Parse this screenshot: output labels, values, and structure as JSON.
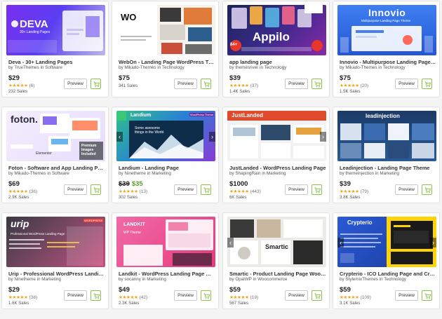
{
  "colors": {
    "star": "#f0a312",
    "cart_green": "#8cc34b",
    "sale_green": "#5a9e2a"
  },
  "buttons": {
    "preview_label": "Preview",
    "cart_icon": "shopping-cart-icon"
  },
  "items": [
    {
      "title": "Deva - 30+ Landing Pages",
      "byline": "by TrueThemes in Software",
      "price": "$29",
      "rating_count": "(6)",
      "sales": "232 Sales",
      "thumb_brand": "DEVA",
      "thumb_tagline": "30+ Landing Pages"
    },
    {
      "title": "WebOn - Landing Page WordPress Theme",
      "byline": "by Mikado-Themes in Technology",
      "price": "$75",
      "sales": "341 Sales"
    },
    {
      "title": "app landing page",
      "byline": "by themesriver in Technology",
      "price": "$39",
      "rating_count": "(37)",
      "sales": "1.4K Sales",
      "thumb_brand": "Appilo",
      "thumb_badge": "84+"
    },
    {
      "title": "Innovio - Multipurpose Landing Page Theme",
      "byline": "by Mikado-Themes in Technology",
      "price": "$75",
      "rating_count": "(20)",
      "sales": "1.5K Sales",
      "thumb_brand": "Innovio",
      "thumb_tagline": "Multipurpose Landing Page Theme"
    },
    {
      "title": "Foton - Software and App Landing Page",
      "byline": "by Mikado-Themes in Software",
      "price": "$69",
      "rating_count": "(36)",
      "sales": "2.9K Sales",
      "thumb_brand": "foton.",
      "thumb_badge": "Premium Images Included",
      "thumb_tagline": "Elementor"
    },
    {
      "title": "Landium - Landing Page",
      "byline": "by Ninetheme in Marketing",
      "price": "$39",
      "sale_price": "$35",
      "rating_count": "(13)",
      "sales": "302 Sales",
      "thumb_brand": "Landium",
      "thumb_tagline": "Some awesome things in the World",
      "thumb_badge": "WordPress Theme"
    },
    {
      "title": "JustLanded - WordPress Landing Page",
      "byline": "by ShapingRain in Marketing",
      "price": "$1000",
      "rating_count": "(443)",
      "sales": "6K Sales",
      "thumb_brand": "JustLanded"
    },
    {
      "title": "Leadinjection - Landing Page Theme",
      "byline": "by themeinjection in Marketing",
      "price": "$39",
      "rating_count": "(79)",
      "sales": "3.8K Sales",
      "thumb_brand": "leadinjection"
    },
    {
      "title": "Urip - Professional WordPress Landing Page",
      "byline": "by Ninetheme in Marketing",
      "price": "$29",
      "rating_count": "(38)",
      "sales": "1.6K Sales",
      "thumb_brand": "urip",
      "thumb_tagline": "Professional WordPress Landing Page",
      "thumb_badge": "WORDPRESS"
    },
    {
      "title": "Landkit - WordPress Landing Page WP Theme",
      "byline": "by socanny in Marketing",
      "price": "$49",
      "rating_count": "(42)",
      "sales": "2.3K Sales",
      "thumb_brand": "LANDKIT",
      "thumb_tagline": "WP Theme"
    },
    {
      "title": "Smartic - Product Landing Page WooCommerce",
      "byline": "by OpalWP in Woocommerce",
      "price": "$59",
      "rating_count": "(19)",
      "sales": "567 Sales",
      "thumb_brand": "Smartic"
    },
    {
      "title": "Crypterio - ICO Landing Page and Crypto",
      "byline": "by StylemixThemes in Technology",
      "price": "$59",
      "rating_count": "(109)",
      "sales": "3.1K Sales",
      "thumb_brand": "Crypterio"
    }
  ]
}
